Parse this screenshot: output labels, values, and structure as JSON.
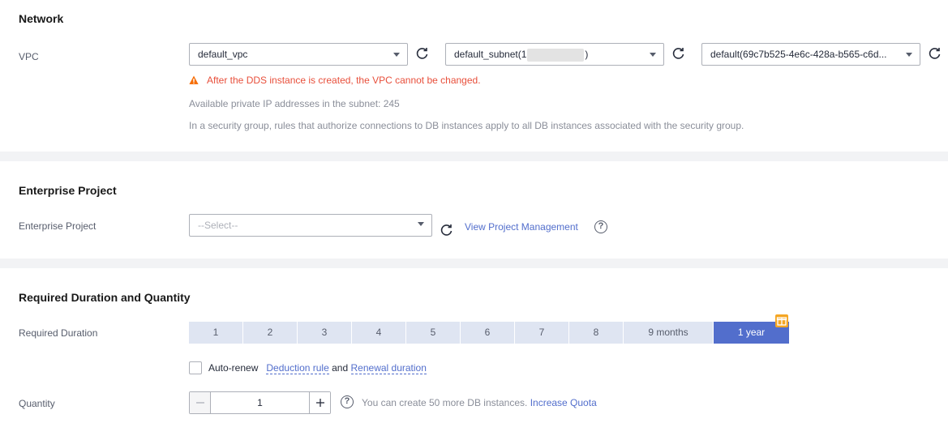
{
  "network": {
    "title": "Network",
    "vpc_label": "VPC",
    "vpc_value": "default_vpc",
    "subnet_prefix": "default_subnet(1",
    "subnet_suffix": ")",
    "security_group_value": "default(69c7b525-4e6c-428a-b565-c6d...",
    "warning": "After the DDS instance is created, the VPC cannot be changed.",
    "available_ips": "Available private IP addresses in the subnet: 245",
    "sg_note": "In a security group, rules that authorize connections to DB instances apply to all DB instances associated with the security group."
  },
  "enterprise": {
    "title": "Enterprise Project",
    "label": "Enterprise Project",
    "placeholder": "--Select--",
    "view_link": "View Project Management",
    "help": "?"
  },
  "duration": {
    "title": "Required Duration and Quantity",
    "label": "Required Duration",
    "options": [
      "1",
      "2",
      "3",
      "4",
      "5",
      "6",
      "7",
      "8",
      "9 months",
      "1 year"
    ],
    "selected": "1 year",
    "auto_renew_label": "Auto-renew",
    "deduction_link": "Deduction rule",
    "and_text": "and",
    "renewal_link": "Renewal duration",
    "quantity_label": "Quantity",
    "quantity_value": "1",
    "quota_help": "?",
    "quota_text": "You can create 50 more DB instances.",
    "increase_link": "Increase Quota"
  },
  "colors": {
    "accent": "#526ecc",
    "warning": "#e84f3b",
    "duration_bg": "#dfe5f2"
  }
}
